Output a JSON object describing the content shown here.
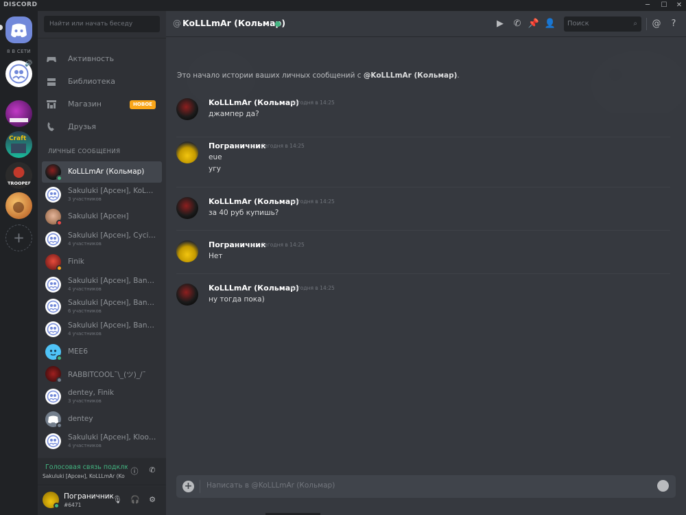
{
  "app": {
    "brand": "DISCORD"
  },
  "window": {
    "minimize": "─",
    "maximize": "☐",
    "close": "✕"
  },
  "guilds": {
    "online_label": "8 В СЕТИ",
    "items": [
      {
        "name": "home",
        "color": "#7289da"
      },
      {
        "name": "voice-group",
        "color": "#ffffff"
      },
      {
        "name": "server-purple",
        "label": "FORNITE TEAM",
        "color": "#8e44ad"
      },
      {
        "name": "server-craft",
        "label": "Craft",
        "color": "#2c3e50"
      },
      {
        "name": "server-troopers",
        "label": "TROOPERS",
        "color": "#2c2c2c"
      },
      {
        "name": "server-cartoon",
        "color": "#e67e22"
      }
    ]
  },
  "sidebar": {
    "search_placeholder": "Найти или начать беседу",
    "nav": [
      {
        "label": "Активность",
        "icon": "gamepad-icon"
      },
      {
        "label": "Библиотека",
        "icon": "library-icon"
      },
      {
        "label": "Магазин",
        "icon": "store-icon",
        "badge": "НОВОЕ"
      },
      {
        "label": "Друзья",
        "icon": "friends-icon"
      }
    ],
    "dm_header": "ЛИЧНЫЕ СООБЩЕНИЯ",
    "dms": [
      {
        "name": "KoLLLmAr (Кольмар)",
        "status": "#43b581",
        "active": true,
        "avatar": "dark"
      },
      {
        "name": "Sakuluki [Арсен], KoLLL...",
        "sub": "3 участников",
        "avatar": "group"
      },
      {
        "name": "Sakuluki [Арсен]",
        "status": "#f04747",
        "avatar": "face"
      },
      {
        "name": "Sakuluki [Арсен], Cycik...",
        "sub": "4 участников",
        "avatar": "group"
      },
      {
        "name": "Finik",
        "status": "#faa61a",
        "avatar": "red"
      },
      {
        "name": "Sakuluki [Арсен], Bank...",
        "sub": "4 участников",
        "avatar": "group"
      },
      {
        "name": "Sakuluki [Арсен], Bank...",
        "sub": "6 участников",
        "avatar": "group"
      },
      {
        "name": "Sakuluki [Арсен], Bank...",
        "sub": "4 участников",
        "avatar": "group"
      },
      {
        "name": "MEE6",
        "status": "#43b581",
        "avatar": "mee6"
      },
      {
        "name": "RABBITCOOL¯\\_(ツ)_/¯",
        "status": "#747f8d",
        "avatar": "maroon"
      },
      {
        "name": "dentey, Finik",
        "sub": "3 участников",
        "avatar": "group"
      },
      {
        "name": "dentey",
        "status": "#747f8d",
        "avatar": "discord"
      },
      {
        "name": "Sakuluki [Арсен], Kloos...",
        "sub": "4 участников",
        "avatar": "group"
      }
    ]
  },
  "voice": {
    "title": "Голосовая связь подклю",
    "subtitle": "Sakuluki [Арсен], KoLLLmAr (Ko..."
  },
  "user": {
    "name": "Пограничник",
    "tag": "#6471"
  },
  "chat": {
    "at_symbol": "@",
    "title": "KoLLLmAr (Кольмар)",
    "search_placeholder": "Поиск",
    "intro_prefix": "Это начало истории ваших личных сообщений с ",
    "intro_name": "@KoLLLmAr (Кольмар)",
    "intro_suffix": ".",
    "composer_placeholder": "Написать в @KoLLLmAr (Кольмар)",
    "messages": [
      {
        "author": "KoLLLmAr (Кольмар)",
        "time": "Сегодня в 14:25",
        "lines": [
          "джампер да?"
        ],
        "avatar": "dark"
      },
      {
        "author": "Пограничник",
        "time": "Сегодня в 14:25",
        "lines": [
          "eue",
          "угу"
        ],
        "avatar": "yellow"
      },
      {
        "author": "KoLLLmAr (Кольмар)",
        "time": "Сегодня в 14:25",
        "lines": [
          "за 40 руб купишь?"
        ],
        "avatar": "dark"
      },
      {
        "author": "Пограничник",
        "time": "Сегодня в 14:25",
        "lines": [
          "Нет"
        ],
        "avatar": "yellow"
      },
      {
        "author": "KoLLLmAr (Кольмар)",
        "time": "Сегодня в 14:25",
        "lines": [
          "ну тогда пока)"
        ],
        "avatar": "dark"
      }
    ]
  }
}
